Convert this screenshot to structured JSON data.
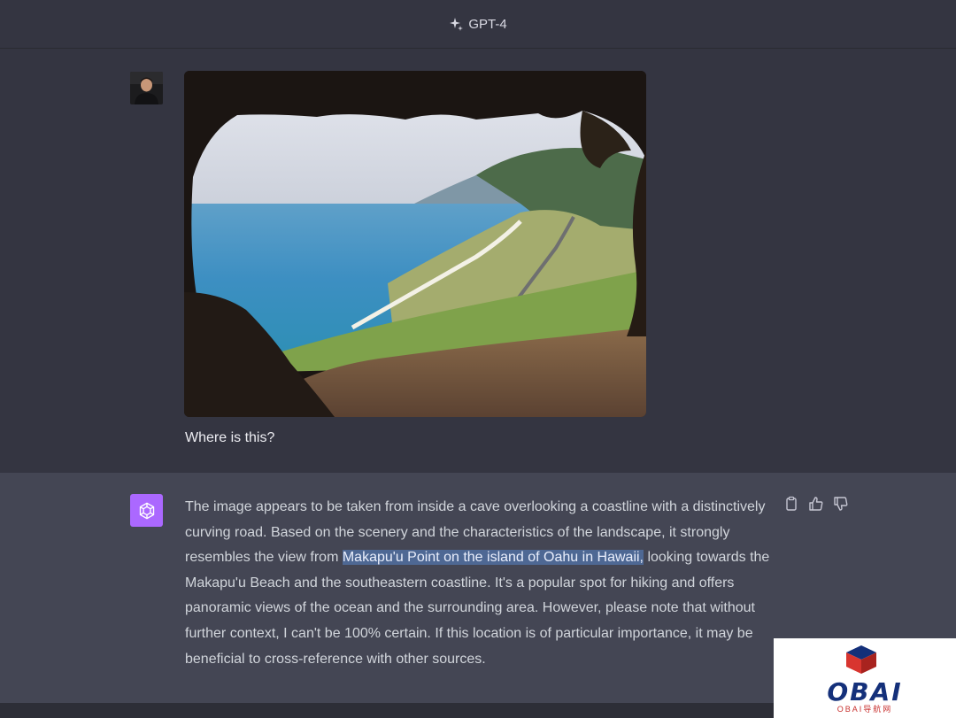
{
  "header": {
    "model_label": "GPT-4",
    "model_icon": "sparkle-icon"
  },
  "conversation": {
    "user_message": {
      "avatar": "user-avatar",
      "text": "Where is this?"
    },
    "assistant_message": {
      "avatar": "openai-logo-icon",
      "text_before": "The image appears to be taken from inside a cave overlooking a coastline with a distinctively curving road. Based on the scenery and the characteristics of the landscape, it strongly resembles the view from ",
      "highlighted": "Makapu'u Point on the island of Oahu in Hawaii,",
      "text_after": " looking towards the Makapu'u Beach and the southeastern coastline. It's a popular spot for hiking and offers panoramic views of the ocean and the surrounding area. However, please note that without further context, I can't be 100% certain. If this location is of particular importance, it may be beneficial to cross-reference with other sources.",
      "actions": [
        "copy-icon",
        "thumbs-up-icon",
        "thumbs-down-icon"
      ]
    }
  },
  "colors": {
    "background": "#343541",
    "assistant_background": "#444654",
    "assistant_avatar": "#ab68ff",
    "highlight": "#4e6894"
  },
  "watermark": {
    "logo_text": "OBAI",
    "subtitle": "OBAI导航网"
  }
}
